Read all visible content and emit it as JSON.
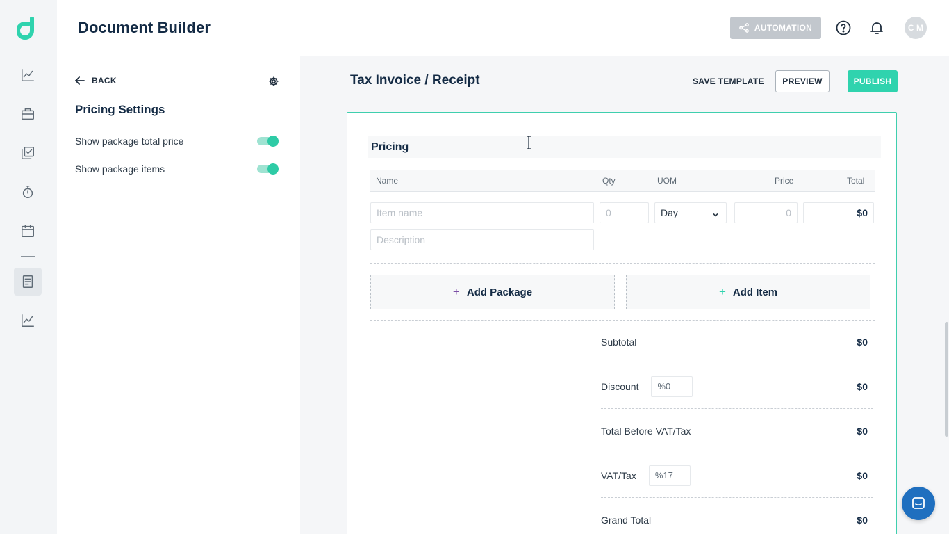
{
  "header": {
    "title": "Document Builder",
    "automation_label": "AUTOMATION",
    "avatar_initials": "C M"
  },
  "sidebar": {
    "items": [
      {
        "icon": "chart-line-icon"
      },
      {
        "icon": "briefcase-icon"
      },
      {
        "icon": "checklist-copy-icon"
      },
      {
        "icon": "stopwatch-icon"
      },
      {
        "icon": "calendar-icon"
      },
      {
        "icon": "document-icon",
        "active": true
      },
      {
        "icon": "chart-line-icon"
      }
    ]
  },
  "settings_panel": {
    "back_label": "BACK",
    "title": "Pricing Settings",
    "options": [
      {
        "label": "Show package total price",
        "enabled": true
      },
      {
        "label": "Show package items",
        "enabled": true
      }
    ]
  },
  "toolbar": {
    "document_title": "Tax Invoice / Receipt",
    "save_template_label": "SAVE TEMPLATE",
    "preview_label": "PREVIEW",
    "publish_label": "PUBLISH"
  },
  "pricing": {
    "section_title": "Pricing",
    "columns": {
      "name": "Name",
      "qty": "Qty",
      "uom": "UOM",
      "price": "Price",
      "total": "Total"
    },
    "item_row": {
      "name_placeholder": "Item name",
      "description_placeholder": "Description",
      "qty_placeholder": "0",
      "uom_value": "Day",
      "price_placeholder": "0",
      "total_value": "$0"
    },
    "add_package_label": "Add Package",
    "add_item_label": "Add Item",
    "summary": {
      "subtotal_label": "Subtotal",
      "subtotal_value": "$0",
      "discount_label": "Discount",
      "discount_input": "%0",
      "discount_value": "$0",
      "before_tax_label": "Total Before VAT/Tax",
      "before_tax_value": "$0",
      "vat_label": "VAT/Tax",
      "vat_input": "%17",
      "vat_value": "$0",
      "grand_total_label": "Grand Total",
      "grand_total_value": "$0"
    }
  },
  "colors": {
    "accent": "#2fd3ae",
    "border_accent": "#3fcfae",
    "automation_bg": "#c2c7cd",
    "chat_bg": "#1f6fbf"
  }
}
